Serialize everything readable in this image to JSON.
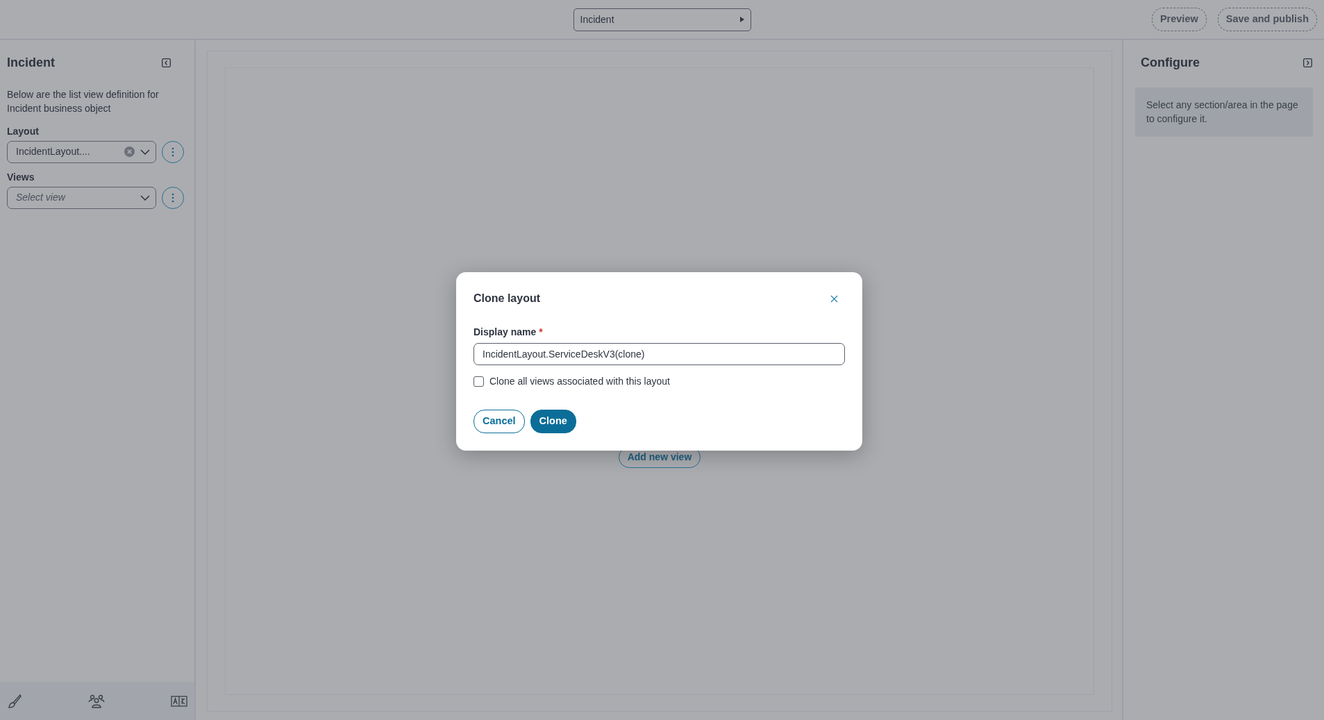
{
  "top_bar": {
    "object_selector": "Incident",
    "buttons": [
      "Preview",
      "Save and publish"
    ]
  },
  "left_panel": {
    "title": "Incident",
    "description": "Below are the list view definition for Incident business object",
    "fields": [
      {
        "label": "Layout",
        "value": "IncidentLayout....",
        "clearable": true
      },
      {
        "label": "Views",
        "placeholder": "Select view",
        "clearable": false
      }
    ]
  },
  "canvas": {
    "add_button": "Add new view"
  },
  "right_panel": {
    "title": "Configure",
    "hint": "Select any section/area in the page to configure it."
  },
  "dialog": {
    "title": "Clone layout",
    "field_label": "Display name",
    "required_mark": "*",
    "field_value": "IncidentLayout.ServiceDeskV3(clone)",
    "checkbox": {
      "label": "Clone all views associated with this layout",
      "checked": false
    },
    "buttons": [
      {
        "label": "Cancel",
        "kind": "outline"
      },
      {
        "label": "Clone",
        "kind": "primary"
      }
    ]
  }
}
